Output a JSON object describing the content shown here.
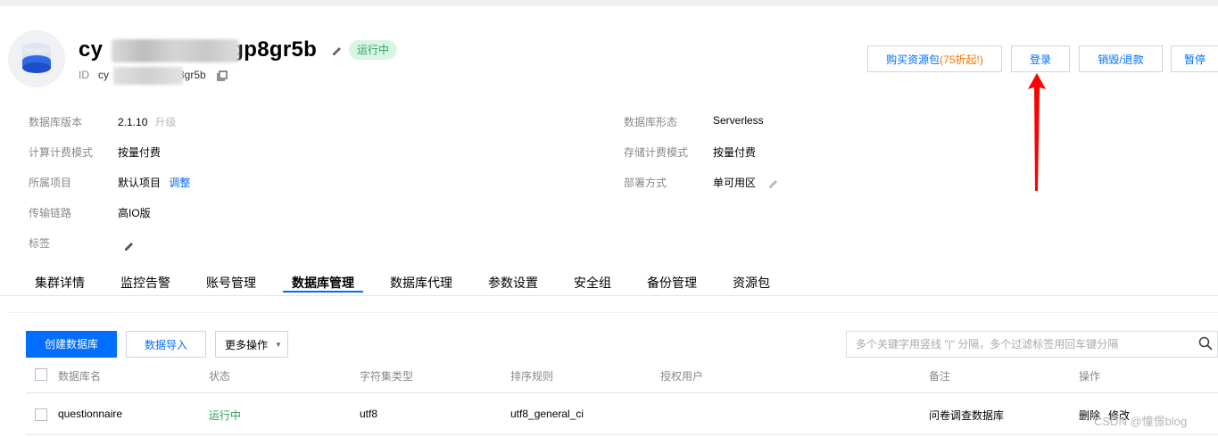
{
  "header": {
    "instance_name_prefix": "cy",
    "instance_name_suffix": "gp8gr5b",
    "status_badge": "运行中",
    "id_label": "ID",
    "id_prefix": "cy",
    "id_suffix": "8gr5b"
  },
  "actions": {
    "buy_pack_label": "购买资源包",
    "buy_pack_discount": "(75折起!)",
    "login_label": "登录",
    "destroy_label": "销毁/退款",
    "pause_label": "暂停"
  },
  "info": {
    "db_version_label": "数据库版本",
    "db_version_value": "2.1.10",
    "upgrade_link": "升级",
    "compute_billing_label": "计算计费模式",
    "compute_billing_value": "按量付费",
    "project_label": "所属项目",
    "project_value": "默认项目",
    "adjust_link": "调整",
    "transport_label": "传输链路",
    "transport_value": "高IO版",
    "tags_label": "标签",
    "db_form_label": "数据库形态",
    "db_form_value": "Serverless",
    "storage_billing_label": "存储计费模式",
    "storage_billing_value": "按量付费",
    "deploy_label": "部署方式",
    "deploy_value": "单可用区"
  },
  "tabs": [
    "集群详情",
    "监控告警",
    "账号管理",
    "数据库管理",
    "数据库代理",
    "参数设置",
    "安全组",
    "备份管理",
    "资源包"
  ],
  "toolbar": {
    "create_label": "创建数据库",
    "import_label": "数据导入",
    "more_label": "更多操作",
    "search_placeholder": "多个关键字用竖线 \"|\" 分隔，多个过滤标签用回车键分隔"
  },
  "table": {
    "headers": [
      "数据库名",
      "状态",
      "字符集类型",
      "排序规则",
      "授权用户",
      "备注",
      "操作"
    ],
    "rows": [
      {
        "name": "questionnaire",
        "status": "运行中",
        "charset": "utf8",
        "collation": "utf8_general_ci",
        "users": "",
        "remark": "问卷调查数据库",
        "op_delete": "删除",
        "op_edit": "修改"
      }
    ]
  },
  "watermark": "CSDN @憧憬blog",
  "colors": {
    "accent": "#006eff",
    "success": "#29a35a",
    "warning": "#ff7200",
    "annotation_arrow": "#ff0000"
  }
}
